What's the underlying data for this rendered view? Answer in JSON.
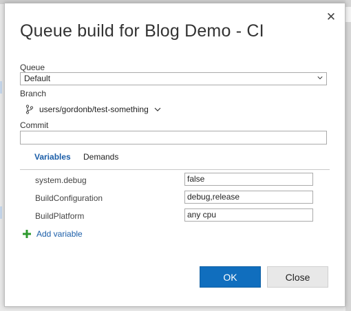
{
  "dialog": {
    "title": "Queue build for Blog Demo - CI",
    "close_icon": "close-icon"
  },
  "queue": {
    "label": "Queue",
    "selected": "Default"
  },
  "branch": {
    "label": "Branch",
    "value": "users/gordonb/test-something"
  },
  "commit": {
    "label": "Commit",
    "value": ""
  },
  "tabs": [
    {
      "label": "Variables",
      "active": true
    },
    {
      "label": "Demands",
      "active": false
    }
  ],
  "variables": [
    {
      "name": "system.debug",
      "value": "false"
    },
    {
      "name": "BuildConfiguration",
      "value": "debug,release"
    },
    {
      "name": "BuildPlatform",
      "value": "any cpu"
    }
  ],
  "add_variable_label": "Add variable",
  "buttons": {
    "ok": "OK",
    "close": "Close"
  },
  "colors": {
    "accent": "#106ebe",
    "link": "#1a5da8",
    "add_icon": "#2e9a2e"
  }
}
